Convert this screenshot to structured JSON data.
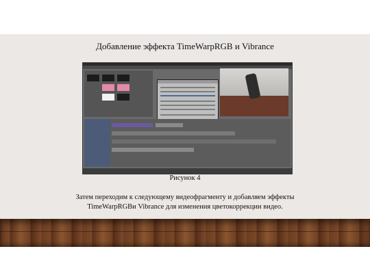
{
  "slide": {
    "title": "Добавление эффекта TimeWarpRGB и Vibrance",
    "figure_caption": "Рисунок 4",
    "description_line1": "Затем переходим к следующему видеофрагменту и добавляем эффекты",
    "description_line2": "TimeWarpRGBи Vibrance для изменения цветокоррекции видео."
  },
  "colors": {
    "slide_background": "#ebe8e6",
    "floor_wood": "#6b3d22"
  }
}
